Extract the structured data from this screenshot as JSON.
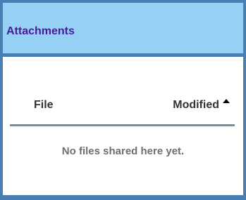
{
  "panel": {
    "title": "Attachments"
  },
  "table": {
    "columns": [
      {
        "label": "File"
      },
      {
        "label": "Modified"
      }
    ],
    "sort": {
      "column": "Modified",
      "direction": "ascending",
      "icon": "sort-ascending-icon"
    },
    "empty_message": "No files shared here yet."
  },
  "colors": {
    "frame": "#4a7fb3",
    "header_bg": "#96d1f5",
    "title": "#4a1a9c",
    "divider": "#7a8c98",
    "empty_text": "#6e6e6e"
  }
}
